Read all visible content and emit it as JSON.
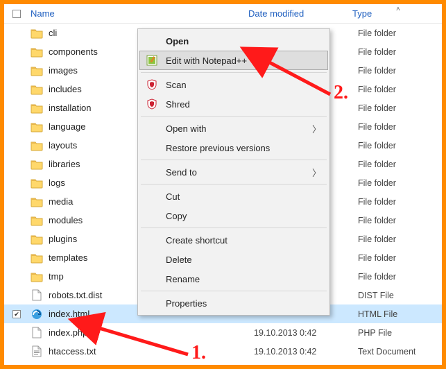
{
  "columns": {
    "name": "Name",
    "date": "Date modified",
    "type": "Type"
  },
  "files": [
    {
      "name": "cli",
      "kind": "folder",
      "date": "",
      "type": "File folder"
    },
    {
      "name": "components",
      "kind": "folder",
      "date": "",
      "type": "File folder"
    },
    {
      "name": "images",
      "kind": "folder",
      "date": "",
      "type": "File folder"
    },
    {
      "name": "includes",
      "kind": "folder",
      "date": "",
      "type": "File folder"
    },
    {
      "name": "installation",
      "kind": "folder",
      "date": "",
      "type": "File folder"
    },
    {
      "name": "language",
      "kind": "folder",
      "date": "",
      "type": "File folder"
    },
    {
      "name": "layouts",
      "kind": "folder",
      "date": "",
      "type": "File folder"
    },
    {
      "name": "libraries",
      "kind": "folder",
      "date": "",
      "type": "File folder"
    },
    {
      "name": "logs",
      "kind": "folder",
      "date": "",
      "type": "File folder"
    },
    {
      "name": "media",
      "kind": "folder",
      "date": "",
      "type": "File folder"
    },
    {
      "name": "modules",
      "kind": "folder",
      "date": "",
      "type": "File folder"
    },
    {
      "name": "plugins",
      "kind": "folder",
      "date": "",
      "type": "File folder"
    },
    {
      "name": "templates",
      "kind": "folder",
      "date": "",
      "type": "File folder"
    },
    {
      "name": "tmp",
      "kind": "folder",
      "date": "",
      "type": "File folder"
    },
    {
      "name": "robots.txt.dist",
      "kind": "file",
      "date": "",
      "type": "DIST File",
      "icon": "generic"
    },
    {
      "name": "index.html",
      "kind": "file",
      "date": "",
      "type": "HTML File",
      "icon": "edge",
      "selected": true
    },
    {
      "name": "index.php",
      "kind": "file",
      "date": "19.10.2013 0:42",
      "type": "PHP File",
      "icon": "generic"
    },
    {
      "name": "htaccess.txt",
      "kind": "file",
      "date": "19.10.2013 0:42",
      "type": "Text Document",
      "icon": "text"
    }
  ],
  "context_menu": {
    "open": "Open",
    "edit_npp": "Edit with Notepad++",
    "scan": "Scan",
    "shred": "Shred",
    "open_with": "Open with",
    "restore": "Restore previous versions",
    "send_to": "Send to",
    "cut": "Cut",
    "copy": "Copy",
    "shortcut": "Create shortcut",
    "delete": "Delete",
    "rename": "Rename",
    "properties": "Properties"
  },
  "annotations": {
    "one": "1.",
    "two": "2."
  },
  "colors": {
    "accent": "#ff8a00",
    "annotation": "#ff1a1a",
    "selection": "#cce8ff"
  }
}
